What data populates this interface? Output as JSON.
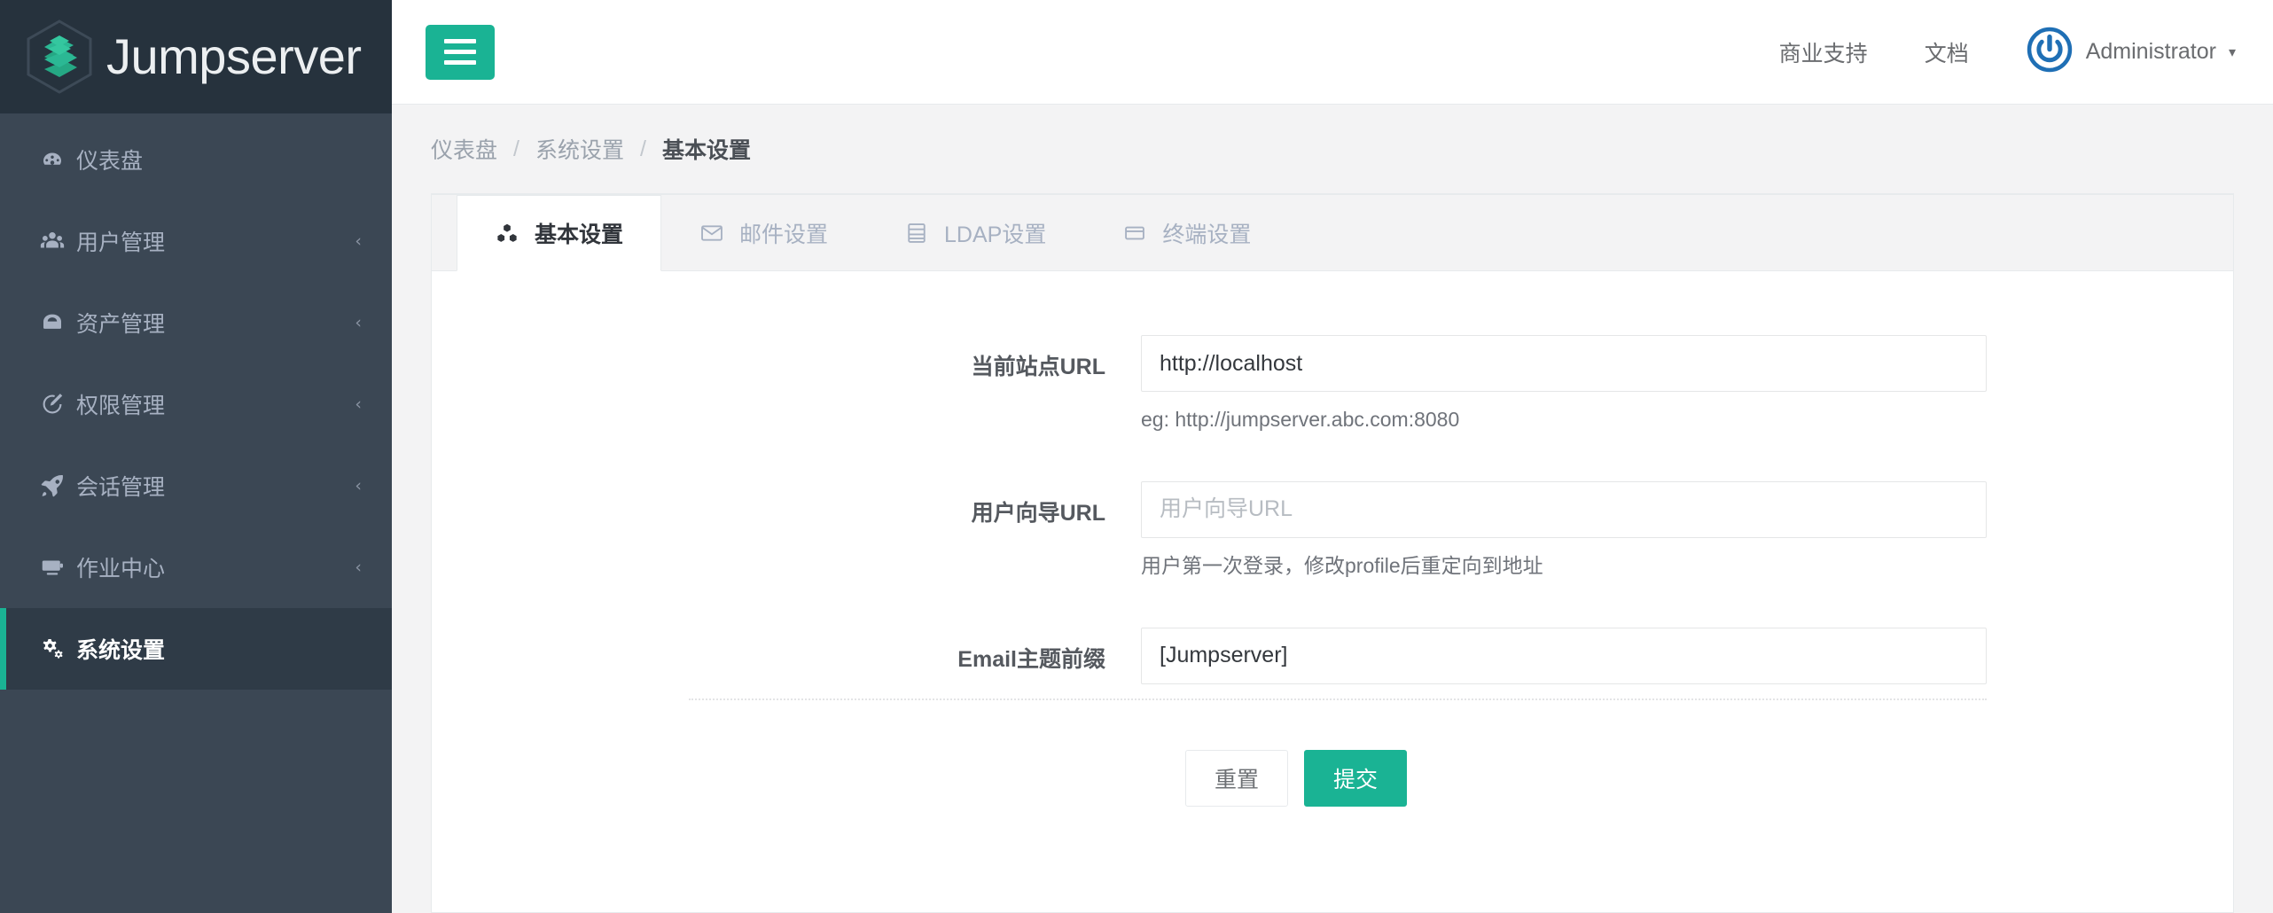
{
  "brand": {
    "name": "Jumpserver",
    "logo_icon": "jumpserver-hexagon-logo",
    "logo_color": "#25a884"
  },
  "sidebar": {
    "items": [
      {
        "label": "仪表盘",
        "icon": "dashboard-icon",
        "expandable": false,
        "active": false
      },
      {
        "label": "用户管理",
        "icon": "users-icon",
        "expandable": true,
        "caret": "‹",
        "active": false
      },
      {
        "label": "资产管理",
        "icon": "assets-cloud-icon",
        "expandable": true,
        "caret": "‹",
        "active": false
      },
      {
        "label": "权限管理",
        "icon": "permission-edit-icon",
        "expandable": true,
        "caret": "‹",
        "active": false
      },
      {
        "label": "会话管理",
        "icon": "rocket-icon",
        "expandable": true,
        "caret": "‹",
        "active": false
      },
      {
        "label": "作业中心",
        "icon": "terminal-screen-icon",
        "expandable": true,
        "caret": "‹",
        "active": false
      },
      {
        "label": "系统设置",
        "icon": "gears-icon",
        "expandable": false,
        "active": true
      }
    ]
  },
  "topbar": {
    "menu_toggle_icon": "hamburger-icon",
    "links": [
      {
        "label": "商业支持",
        "name": "commercial-support"
      },
      {
        "label": "文档",
        "name": "documentation"
      }
    ],
    "user": {
      "name": "Administrator",
      "avatar_icon": "power-button-avatar-icon",
      "avatar_color": "#1f6fb5",
      "caret": "▾"
    }
  },
  "breadcrumb": {
    "items": [
      {
        "label": "仪表盘",
        "current": false
      },
      {
        "label": "系统设置",
        "current": false
      },
      {
        "label": "基本设置",
        "current": true
      }
    ],
    "separator": "/"
  },
  "tabs": [
    {
      "label": "基本设置",
      "icon": "cubes-icon",
      "active": true
    },
    {
      "label": "邮件设置",
      "icon": "envelope-icon",
      "active": false
    },
    {
      "label": "LDAP设置",
      "icon": "database-icon",
      "active": false
    },
    {
      "label": "终端设置",
      "icon": "terminal-icon",
      "active": false
    }
  ],
  "form": {
    "fields": [
      {
        "label": "当前站点URL",
        "value": "http://localhost",
        "placeholder": "",
        "help": "eg: http://jumpserver.abc.com:8080"
      },
      {
        "label": "用户向导URL",
        "value": "",
        "placeholder": "用户向导URL",
        "help": "用户第一次登录，修改profile后重定向到地址"
      },
      {
        "label": "Email主题前缀",
        "value": "[Jumpserver]",
        "placeholder": "",
        "help": ""
      }
    ],
    "buttons": {
      "reset": "重置",
      "submit": "提交"
    }
  },
  "colors": {
    "accent_green": "#1ab394",
    "sidebar_bg": "#3b4754",
    "brand_bg": "#26323d",
    "page_bg": "#f3f3f4"
  }
}
